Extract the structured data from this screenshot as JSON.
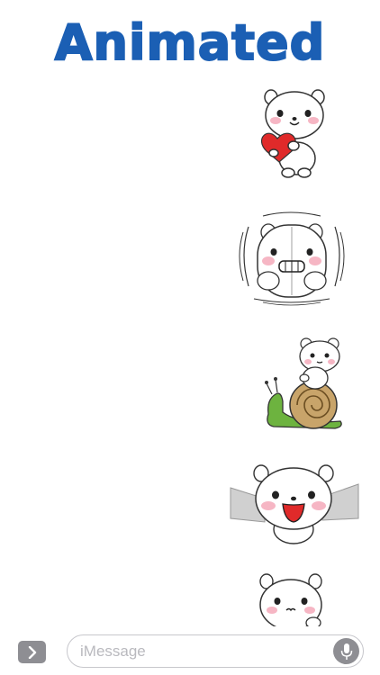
{
  "header": {
    "title": "Animated",
    "title_color": "#1b5fb4"
  },
  "stickers": [
    {
      "name": "bear-holding-heart"
    },
    {
      "name": "bear-shaking-nervous"
    },
    {
      "name": "bear-riding-snail"
    },
    {
      "name": "bear-flying-cheer"
    },
    {
      "name": "bear-peeking"
    }
  ],
  "compose_bar": {
    "app_button_icon": "chevron-right-icon",
    "placeholder": "iMessage",
    "mic_icon": "microphone-icon"
  },
  "colors": {
    "heart": "#e02a2a",
    "snail_body": "#6db33f",
    "snail_shell": "#c8a46a",
    "blush": "#f6b6c4",
    "wings": "#d0d0d0",
    "button_gray": "#8e8e93"
  }
}
